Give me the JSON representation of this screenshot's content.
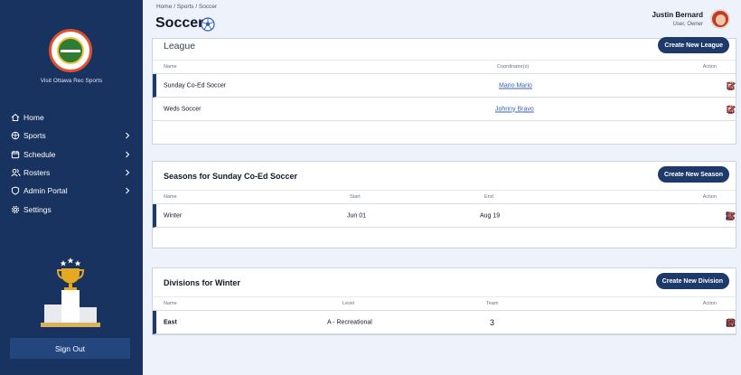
{
  "sidebar": {
    "visit_label": "Visit Ottawa Rec Sports",
    "nav": [
      {
        "label": "Home",
        "icon": "home-icon",
        "has_submenu": false
      },
      {
        "label": "Sports",
        "icon": "sports-ball-icon",
        "has_submenu": true
      },
      {
        "label": "Schedule",
        "icon": "calendar-icon",
        "has_submenu": true
      },
      {
        "label": "Rosters",
        "icon": "users-icon",
        "has_submenu": true
      },
      {
        "label": "Admin Portal",
        "icon": "shield-icon",
        "has_submenu": true
      },
      {
        "label": "Settings",
        "icon": "gear-icon",
        "has_submenu": false
      }
    ],
    "sign_out": "Sign Out"
  },
  "header": {
    "breadcrumb": "Home / Sports / Soccer",
    "title": "Soccer",
    "user_name": "Justin Bernard",
    "user_role": "User, Owner"
  },
  "league": {
    "title": "League",
    "create_label": "Create New League",
    "columns": {
      "name": "Name",
      "coordinator": "Coordinator(s)",
      "action": "Action"
    },
    "rows": [
      {
        "name": "Sunday Co-Ed Soccer",
        "coordinator": "Mario Mario",
        "selected": true
      },
      {
        "name": "Weds Soccer",
        "coordinator": "Johnny Bravo",
        "selected": false
      }
    ]
  },
  "seasons": {
    "title": "Seasons for Sunday Co-Ed Soccer",
    "create_label": "Create New Season",
    "columns": {
      "name": "Name",
      "start": "Start",
      "end": "End",
      "action": "Action"
    },
    "rows": [
      {
        "name": "Winter",
        "start": "Jun 01",
        "end": "Aug 19"
      }
    ]
  },
  "divisions": {
    "title": "Divisions for Winter",
    "create_label": "Create New Division",
    "columns": {
      "name": "Name",
      "level": "Level",
      "team": "Team",
      "action": "Action"
    },
    "rows": [
      {
        "name": "East",
        "level": "A - Recreational",
        "team": "3"
      }
    ]
  },
  "colors": {
    "sidebar": "#18335f",
    "primary": "#1e3a6b",
    "link": "#3b5fb8",
    "danger": "#e0412b",
    "background": "#eef3fb"
  }
}
